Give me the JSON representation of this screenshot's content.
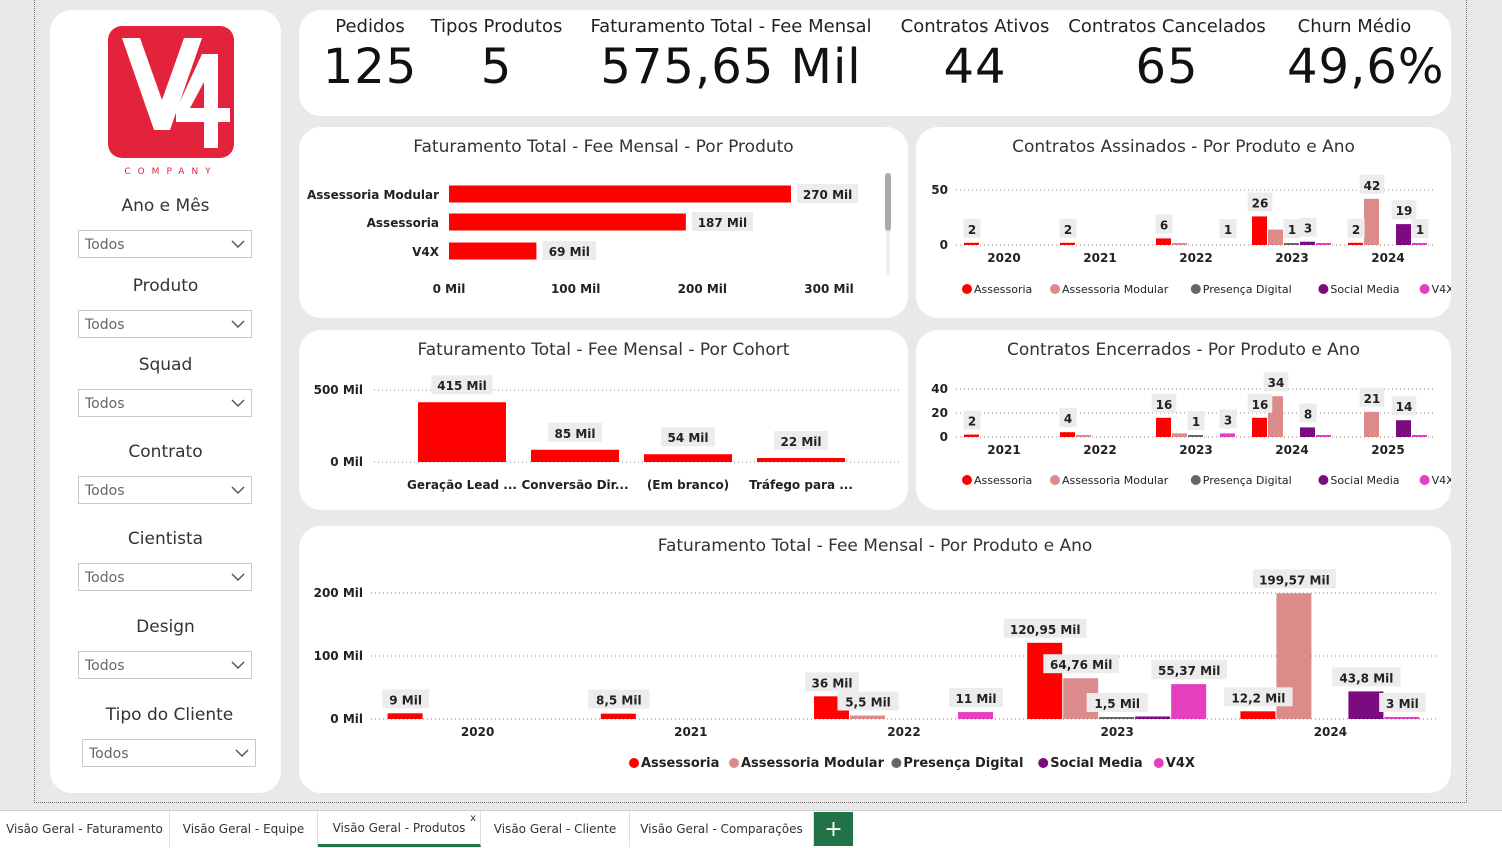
{
  "logo": {
    "brand": "V4",
    "subtitle": "COMPANY",
    "color": "#e3233b"
  },
  "filters": [
    {
      "label": "Ano e Mês",
      "value": "Todos"
    },
    {
      "label": "Produto",
      "value": "Todos"
    },
    {
      "label": "Squad",
      "value": "Todos"
    },
    {
      "label": "Contrato",
      "value": "Todos"
    },
    {
      "label": "Cientista",
      "value": "Todos"
    },
    {
      "label": "Design",
      "value": "Todos"
    },
    {
      "label": "Tipo do Cliente",
      "value": "Todos"
    }
  ],
  "kpis": [
    {
      "label": "Pedidos",
      "value": "125"
    },
    {
      "label": "Tipos Produtos",
      "value": "5"
    },
    {
      "label": "Faturamento Total - Fee Mensal",
      "value": "575,65 Mil"
    },
    {
      "label": "Contratos Ativos",
      "value": "44"
    },
    {
      "label": "Contratos Cancelados",
      "value": "65"
    },
    {
      "label": "Churn Médio",
      "value": "49,6%"
    }
  ],
  "colors": {
    "assessoria": "#ff0000",
    "assessoria_modular": "#dc8b8b",
    "presenca_digital": "#666666",
    "social_media": "#7b0c7f",
    "v4x": "#e53fbf"
  },
  "legend": [
    "Assessoria",
    "Assessoria Modular",
    "Presença Digital",
    "Social Media",
    "V4X"
  ],
  "chart_data": [
    {
      "type": "bar",
      "orientation": "horizontal",
      "title": "Faturamento Total - Fee Mensal - Por Produto",
      "categories": [
        "Assessoria Modular",
        "Assessoria",
        "V4X"
      ],
      "values": [
        270,
        187,
        69
      ],
      "value_labels": [
        "270 Mil",
        "187 Mil",
        "69 Mil"
      ],
      "xticks": [
        "0 Mil",
        "100 Mil",
        "200 Mil",
        "300 Mil"
      ],
      "xlim": [
        0,
        300
      ]
    },
    {
      "type": "bar",
      "title": "Contratos Assinados - Por Produto e Ano",
      "categories": [
        "2020",
        "2021",
        "2022",
        "2023",
        "2024"
      ],
      "yticks": [
        "0",
        "50"
      ],
      "ylim": [
        0,
        50
      ],
      "series": [
        {
          "name": "Assessoria",
          "values": [
            2,
            2,
            6,
            26,
            2
          ]
        },
        {
          "name": "Assessoria Modular",
          "values": [
            0,
            0,
            1,
            14,
            42
          ]
        },
        {
          "name": "Presença Digital",
          "values": [
            0,
            0,
            0,
            1,
            0
          ]
        },
        {
          "name": "Social Media",
          "values": [
            0,
            0,
            0,
            3,
            19
          ]
        },
        {
          "name": "V4X",
          "values": [
            0,
            0,
            0,
            1,
            1
          ]
        }
      ],
      "labels": [
        {
          "cat": 0,
          "s": 0,
          "text": "2"
        },
        {
          "cat": 1,
          "s": 0,
          "text": "2"
        },
        {
          "cat": 2,
          "s": 0,
          "text": "6"
        },
        {
          "cat": 2,
          "s": 4,
          "text": "1"
        },
        {
          "cat": 3,
          "s": 0,
          "text": "26"
        },
        {
          "cat": 3,
          "s": 2,
          "text": "1"
        },
        {
          "cat": 3,
          "s": 3,
          "text": "3"
        },
        {
          "cat": 4,
          "s": 0,
          "text": "2"
        },
        {
          "cat": 4,
          "s": 1,
          "text": "42"
        },
        {
          "cat": 4,
          "s": 3,
          "text": "19"
        },
        {
          "cat": 4,
          "s": 4,
          "text": "1"
        }
      ]
    },
    {
      "type": "bar",
      "title": "Faturamento Total - Fee Mensal - Por Cohort",
      "categories": [
        "Geração Lead ...",
        "Conversão Dir...",
        "(Em branco)",
        "Tráfego para ..."
      ],
      "values": [
        415,
        85,
        54,
        22
      ],
      "value_labels": [
        "415 Mil",
        "85 Mil",
        "54 Mil",
        "22 Mil"
      ],
      "yticks": [
        "0 Mil",
        "500 Mil"
      ],
      "ylim": [
        0,
        500
      ]
    },
    {
      "type": "bar",
      "title": "Contratos Encerrados - Por Produto e Ano",
      "categories": [
        "2021",
        "2022",
        "2023",
        "2024",
        "2025"
      ],
      "yticks": [
        "0",
        "20",
        "40"
      ],
      "ylim": [
        0,
        40
      ],
      "series": [
        {
          "name": "Assessoria",
          "values": [
            2,
            4,
            16,
            16,
            0
          ]
        },
        {
          "name": "Assessoria Modular",
          "values": [
            0,
            1,
            3,
            34,
            21
          ]
        },
        {
          "name": "Presença Digital",
          "values": [
            0,
            0,
            1,
            0,
            0
          ]
        },
        {
          "name": "Social Media",
          "values": [
            0,
            0,
            0,
            8,
            14
          ]
        },
        {
          "name": "V4X",
          "values": [
            0,
            0,
            3,
            1,
            1
          ]
        }
      ],
      "labels": [
        {
          "cat": 0,
          "s": 0,
          "text": "2"
        },
        {
          "cat": 1,
          "s": 0,
          "text": "4"
        },
        {
          "cat": 2,
          "s": 0,
          "text": "16"
        },
        {
          "cat": 2,
          "s": 2,
          "text": "1"
        },
        {
          "cat": 2,
          "s": 4,
          "text": "3"
        },
        {
          "cat": 3,
          "s": 0,
          "text": "16"
        },
        {
          "cat": 3,
          "s": 1,
          "text": "34"
        },
        {
          "cat": 3,
          "s": 3,
          "text": "8"
        },
        {
          "cat": 4,
          "s": 1,
          "text": "21"
        },
        {
          "cat": 4,
          "s": 3,
          "text": "14"
        }
      ]
    },
    {
      "type": "bar",
      "title": "Faturamento Total - Fee Mensal - Por Produto e Ano",
      "categories": [
        "2020",
        "2021",
        "2022",
        "2023",
        "2024"
      ],
      "yticks": [
        "0 Mil",
        "100 Mil",
        "200 Mil"
      ],
      "ylim": [
        0,
        200
      ],
      "series": [
        {
          "name": "Assessoria",
          "values": [
            9,
            8.5,
            36,
            120.95,
            12.2
          ]
        },
        {
          "name": "Assessoria Modular",
          "values": [
            0,
            0,
            5.5,
            64.76,
            199.57
          ]
        },
        {
          "name": "Presença Digital",
          "values": [
            0,
            0,
            0,
            1.5,
            0
          ]
        },
        {
          "name": "Social Media",
          "values": [
            0,
            0,
            0,
            4,
            43.8
          ]
        },
        {
          "name": "V4X",
          "values": [
            0,
            0,
            11,
            55.37,
            3
          ]
        }
      ],
      "labels": [
        {
          "cat": 0,
          "s": 0,
          "text": "9 Mil"
        },
        {
          "cat": 1,
          "s": 0,
          "text": "8,5 Mil"
        },
        {
          "cat": 2,
          "s": 0,
          "text": "36 Mil"
        },
        {
          "cat": 2,
          "s": 1,
          "text": "5,5 Mil"
        },
        {
          "cat": 2,
          "s": 4,
          "text": "11 Mil"
        },
        {
          "cat": 3,
          "s": 0,
          "text": "120,95 Mil"
        },
        {
          "cat": 3,
          "s": 1,
          "text": "64,76 Mil"
        },
        {
          "cat": 3,
          "s": 2,
          "text": "1,5 Mil"
        },
        {
          "cat": 3,
          "s": 4,
          "text": "55,37 Mil"
        },
        {
          "cat": 4,
          "s": 0,
          "text": "12,2 Mil"
        },
        {
          "cat": 4,
          "s": 1,
          "text": "199,57 Mil"
        },
        {
          "cat": 4,
          "s": 3,
          "text": "43,8 Mil"
        },
        {
          "cat": 4,
          "s": 4,
          "text": "3 Mil"
        }
      ]
    }
  ],
  "tabs": [
    {
      "label": "Visão Geral - Faturamento"
    },
    {
      "label": "Visão Geral - Equipe"
    },
    {
      "label": "Visão Geral - Produtos",
      "close": "x"
    },
    {
      "label": "Visão Geral - Cliente"
    },
    {
      "label": "Visão Geral - Comparações"
    }
  ],
  "add_tab_label": "+"
}
